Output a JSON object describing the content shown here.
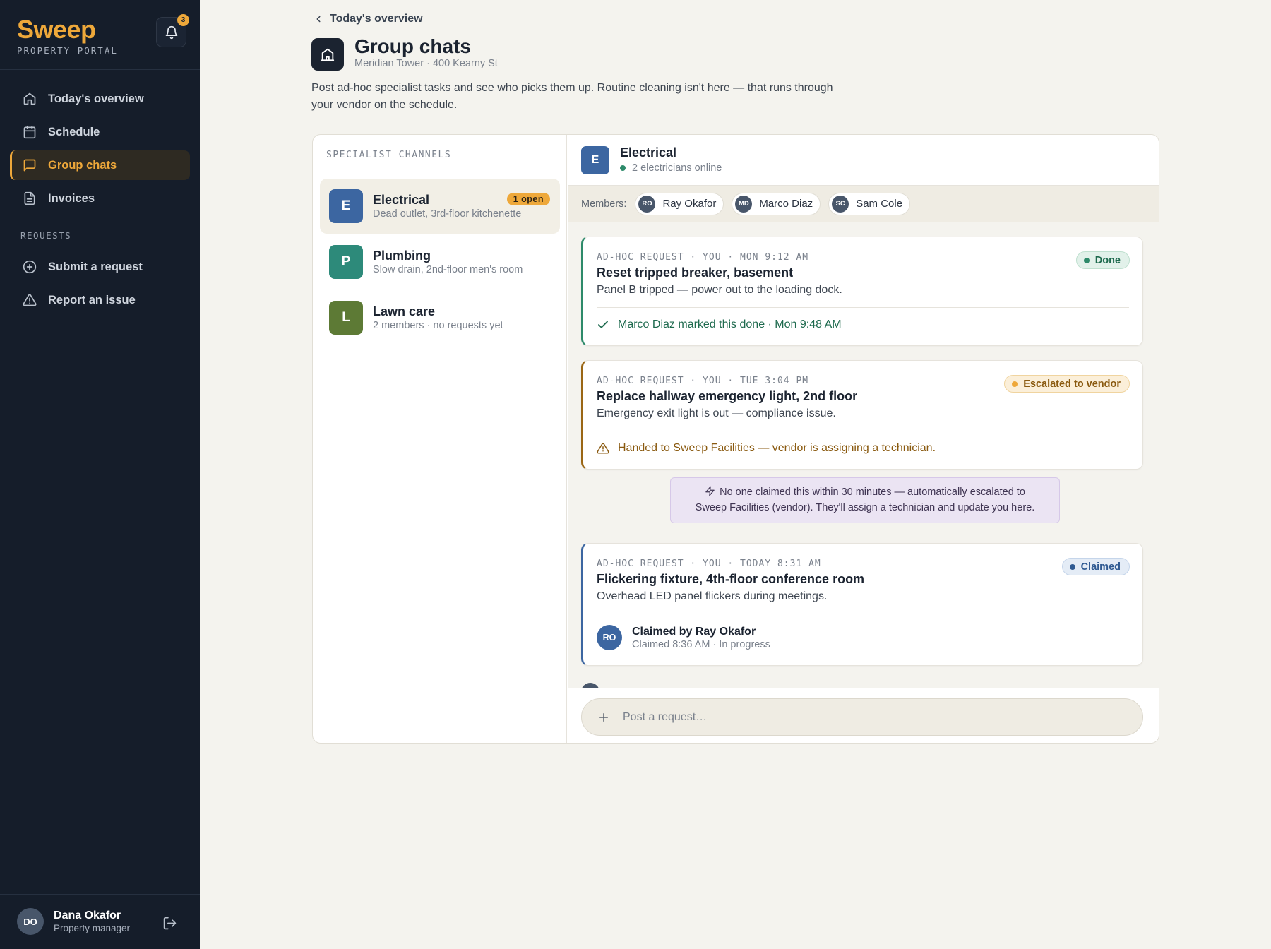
{
  "sidebar": {
    "brand": "Sweep",
    "brand_sub": "PROPERTY PORTAL",
    "notifications_count": "3",
    "nav": [
      {
        "label": "Today's overview",
        "icon": "home-icon"
      },
      {
        "label": "Schedule",
        "icon": "calendar-icon"
      },
      {
        "label": "Group chats",
        "icon": "chat-icon",
        "active": true
      },
      {
        "label": "Invoices",
        "icon": "document-icon"
      }
    ],
    "requests_heading": "REQUESTS",
    "requests_nav": [
      {
        "label": "Submit a request",
        "icon": "plus-circle-icon"
      },
      {
        "label": "Report an issue",
        "icon": "warning-icon"
      }
    ],
    "user": {
      "initials": "DO",
      "name": "Dana Okafor",
      "role": "Property manager"
    }
  },
  "header": {
    "back_label": "Today's overview",
    "title": "Group chats",
    "subtitle": "Meridian Tower · 400 Kearny St",
    "description": "Post ad-hoc specialist tasks and see who picks them up. Routine cleaning isn't here — that runs through your vendor on the schedule."
  },
  "channels": {
    "heading": "SPECIALIST CHANNELS",
    "items": [
      {
        "initial": "E",
        "name": "Electrical",
        "sub": "Dead outlet, 3rd-floor kitchenette",
        "badge": "1 open",
        "color": "#3c66a1"
      },
      {
        "initial": "P",
        "name": "Plumbing",
        "sub": "Slow drain, 2nd-floor men's room",
        "color": "#2d8a7a"
      },
      {
        "initial": "L",
        "name": "Lawn care",
        "sub": "2 members · no requests yet",
        "color": "#5d7a35"
      }
    ]
  },
  "chat": {
    "initial": "E",
    "name": "Electrical",
    "online": "2 electricians online",
    "members_label": "Members:",
    "members": [
      {
        "initials": "RO",
        "name": "Ray Okafor"
      },
      {
        "initials": "MD",
        "name": "Marco Diaz"
      },
      {
        "initials": "SC",
        "name": "Sam Cole"
      }
    ],
    "messages": [
      {
        "meta": "AD-HOC REQUEST · YOU · MON 9:12 AM",
        "title": "Reset tripped breaker, basement",
        "desc": "Panel B tripped — power out to the loading dock.",
        "status": "Done",
        "status_color": "#2d8a6a",
        "foot": "Marco Diaz marked this done · Mon 9:48 AM"
      },
      {
        "meta": "AD-HOC REQUEST · YOU · TUE 3:04 PM",
        "title": "Replace hallway emergency light, 2nd floor",
        "desc": "Emergency exit light is out — compliance issue.",
        "status": "Escalated to vendor",
        "status_color": "#8a5a10",
        "foot": "Handed to Sweep Facilities — vendor is assigning a technician."
      },
      {
        "meta": "AD-HOC REQUEST · YOU · TODAY 8:31 AM",
        "title": "Flickering fixture, 4th-floor conference room",
        "desc": "Overhead LED panel flickers during meetings.",
        "status": "Claimed",
        "status_color": "#2f5a92",
        "claim_initials": "RO",
        "claim_name": "Claimed by Ray Okafor",
        "claim_sub": "Claimed 8:36 AM · In progress"
      }
    ],
    "notice_line1": "No one claimed this within 30 minutes — automatically escalated to",
    "notice_line2": "Sweep Facilities (vendor). They'll assign a technician and update you here.",
    "composer_placeholder": "Post a request…"
  }
}
